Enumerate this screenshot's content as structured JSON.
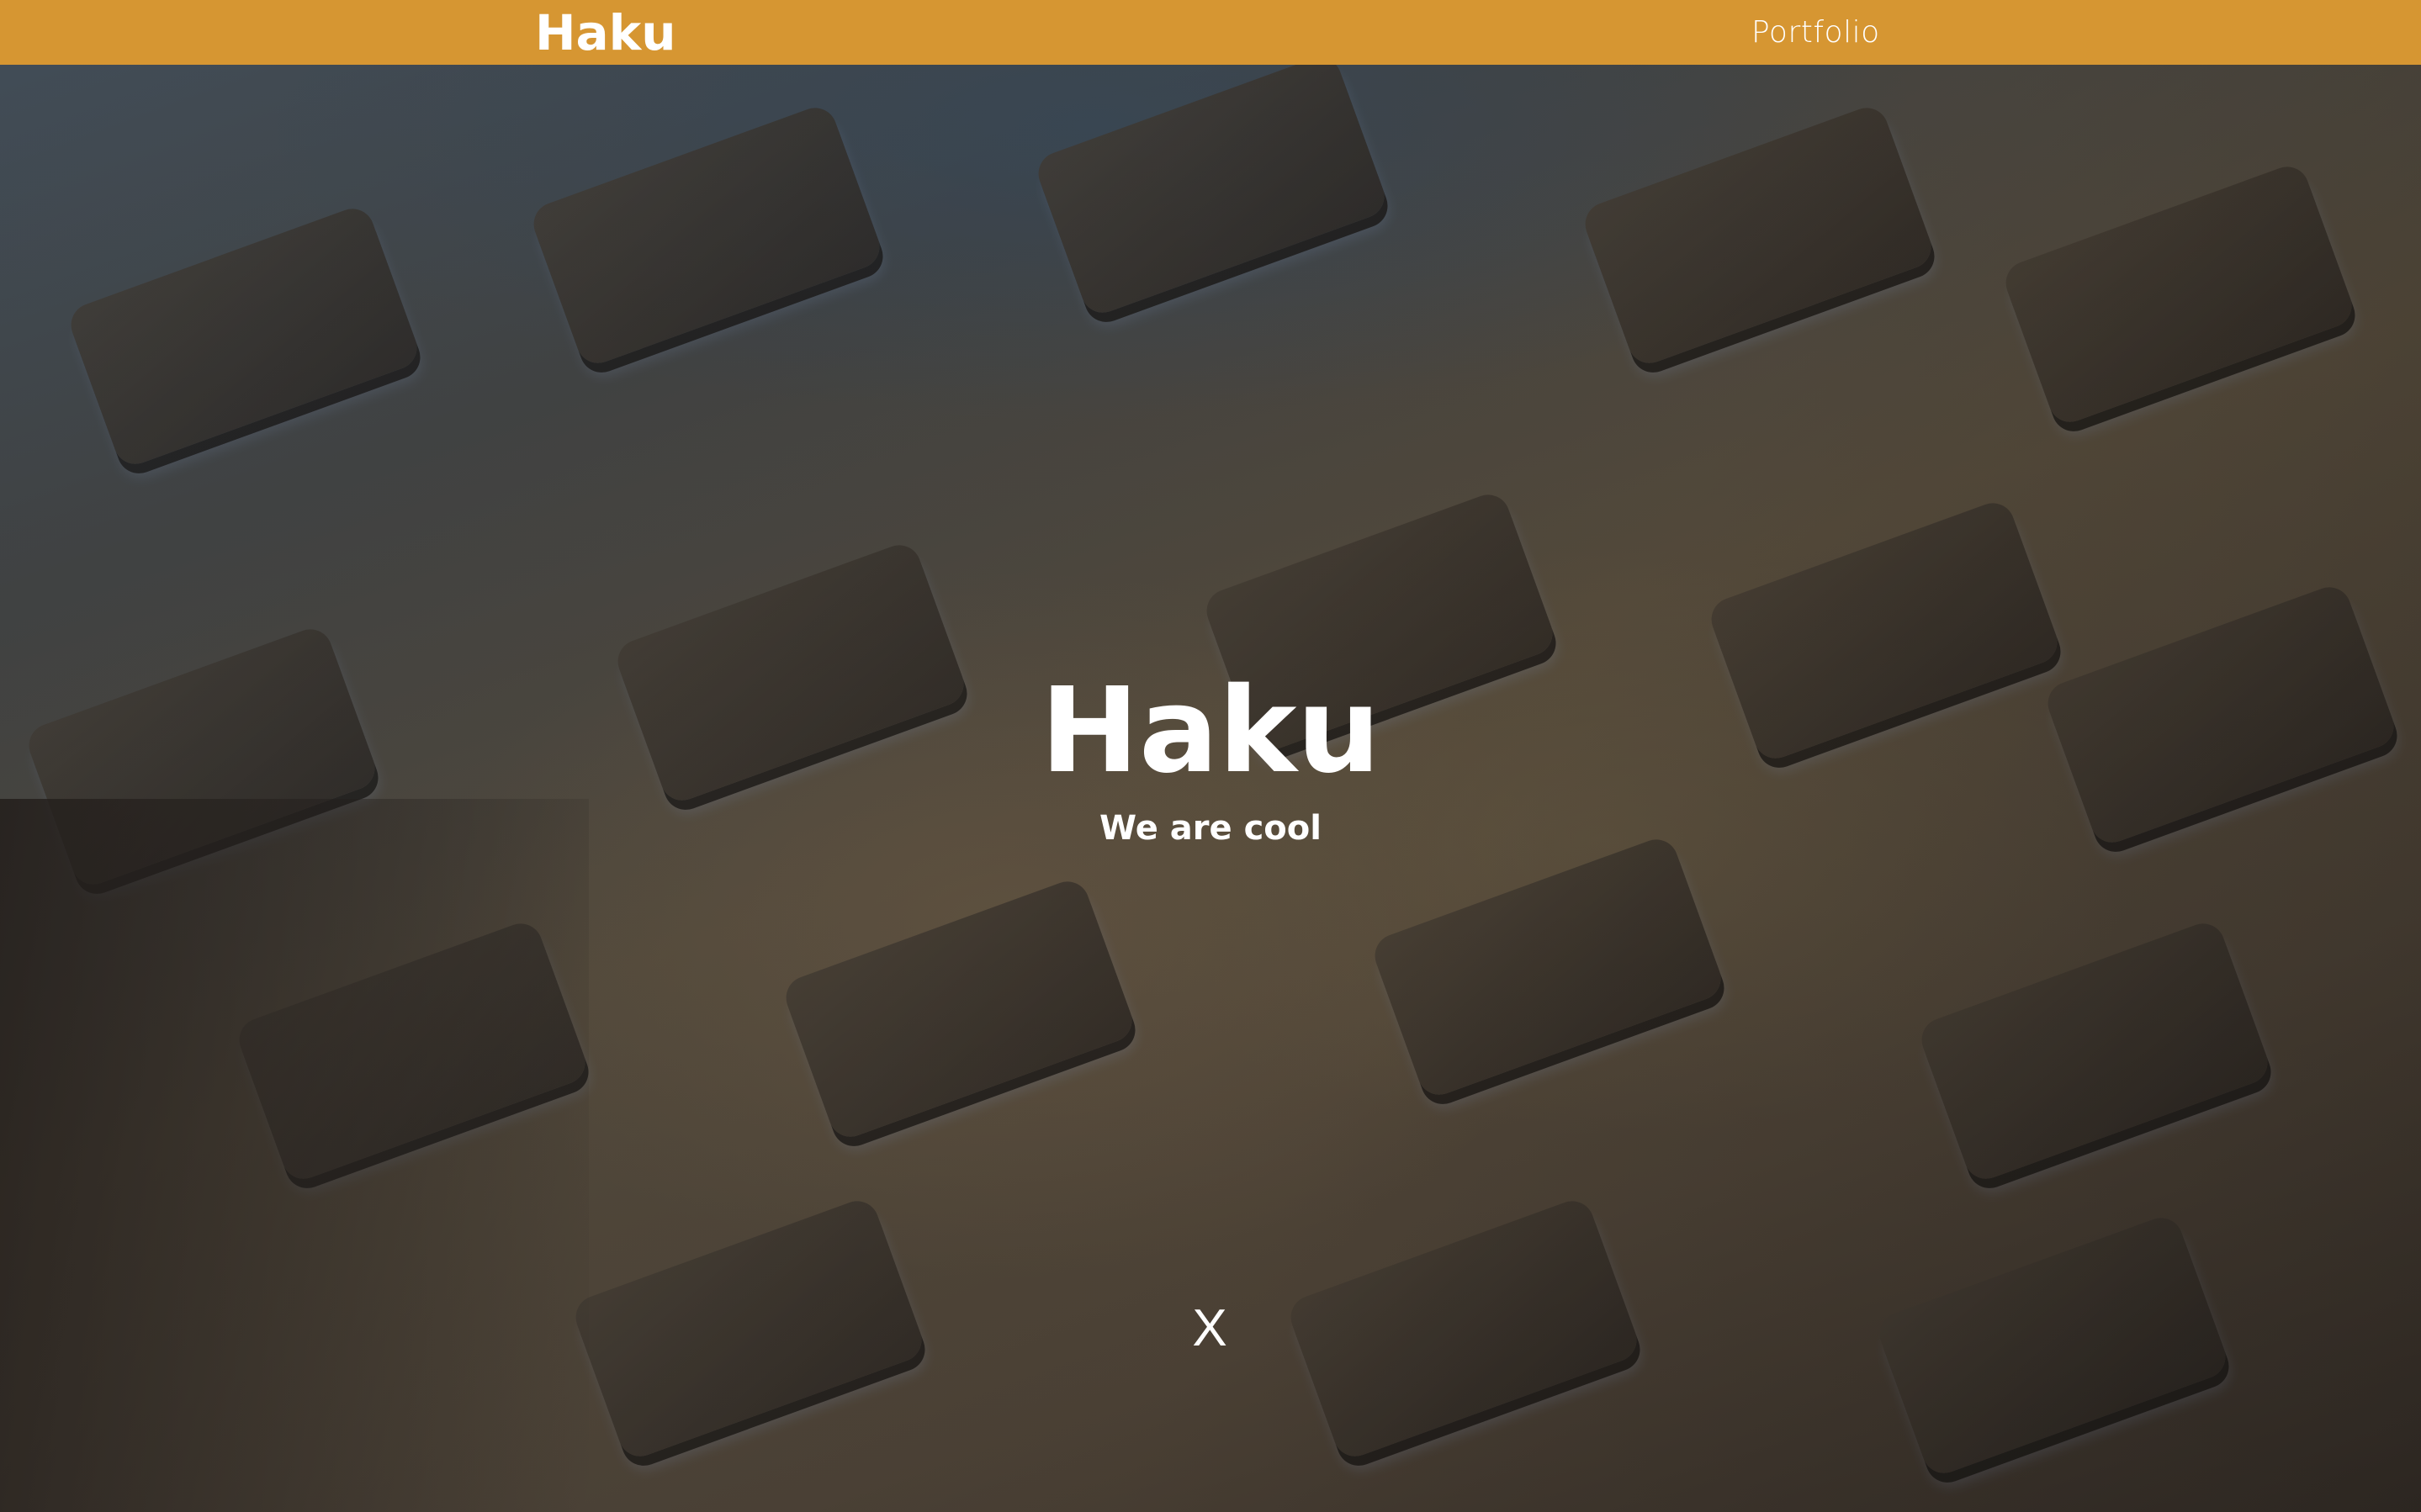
{
  "navbar": {
    "logo": "Haku",
    "links": [
      {
        "label": "Portfolio"
      }
    ],
    "color": "#D69632"
  },
  "hero": {
    "title": "Haku",
    "subtitle": "We are cool",
    "close_label": "X",
    "background": "keyboard-photo"
  }
}
